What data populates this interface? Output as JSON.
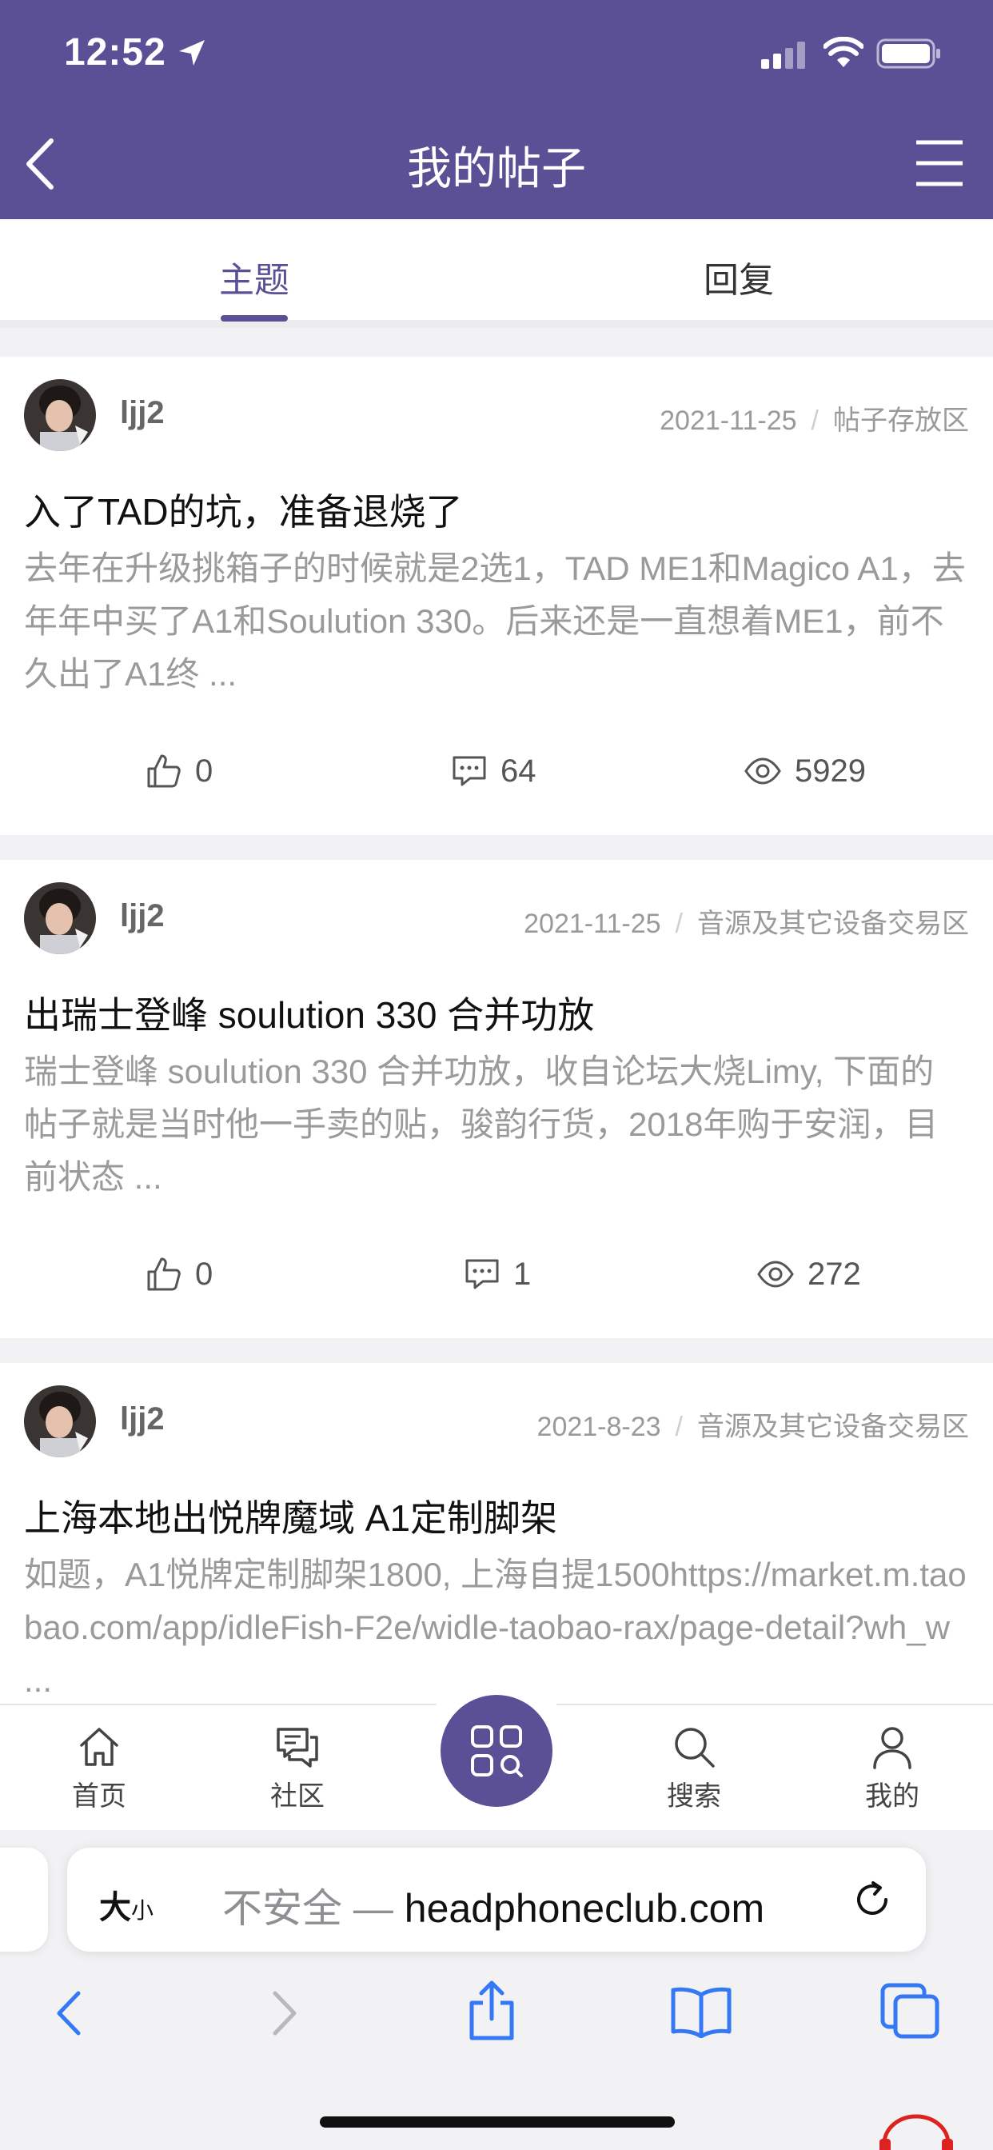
{
  "status_bar": {
    "time": "12:52"
  },
  "nav": {
    "title": "我的帖子"
  },
  "tabs": [
    {
      "label": "主题",
      "active": true
    },
    {
      "label": "回复",
      "active": false
    }
  ],
  "posts": [
    {
      "author": "ljj2",
      "date": "2021-11-25",
      "forum": "帖子存放区",
      "title": "入了TAD的坑，准备退烧了",
      "excerpt": "去年在升级挑箱子的时候就是2选1，TAD ME1和Magico A1，去年年中买了A1和Soulution 330。后来还是一直想着ME1，前不久出了A1终 ...",
      "likes": "0",
      "comments": "64",
      "views": "5929"
    },
    {
      "author": "ljj2",
      "date": "2021-11-25",
      "forum": "音源及其它设备交易区",
      "title": "出瑞士登峰 soulution 330 合并功放",
      "excerpt": "瑞士登峰 soulution 330 合并功放，收自论坛大烧Limy, 下面的帖子就是当时他一手卖的贴，骏韵行货，2018年购于安润，目前状态 ...",
      "likes": "0",
      "comments": "1",
      "views": "272"
    },
    {
      "author": "ljj2",
      "date": "2021-8-23",
      "forum": "音源及其它设备交易区",
      "title": "上海本地出悦牌魔域 A1定制脚架",
      "excerpt": "如题，A1悦牌定制脚架1800, 上海自提1500https://market.m.taobao.com/app/idleFish-F2e/widle-taobao-rax/page-detail?wh_w ..."
    }
  ],
  "bottom_tabs": [
    {
      "label": "首页",
      "icon": "home-icon"
    },
    {
      "label": "社区",
      "icon": "chat-icon"
    },
    {
      "label": "搜索",
      "icon": "search-icon"
    },
    {
      "label": "我的",
      "icon": "user-icon"
    }
  ],
  "browser": {
    "text_size": "大",
    "text_size_small": "小",
    "insecure_label": "不安全 — ",
    "domain": "headphoneclub.com"
  },
  "colors": {
    "accent": "#5b4f95",
    "link_blue": "#3478f6"
  }
}
